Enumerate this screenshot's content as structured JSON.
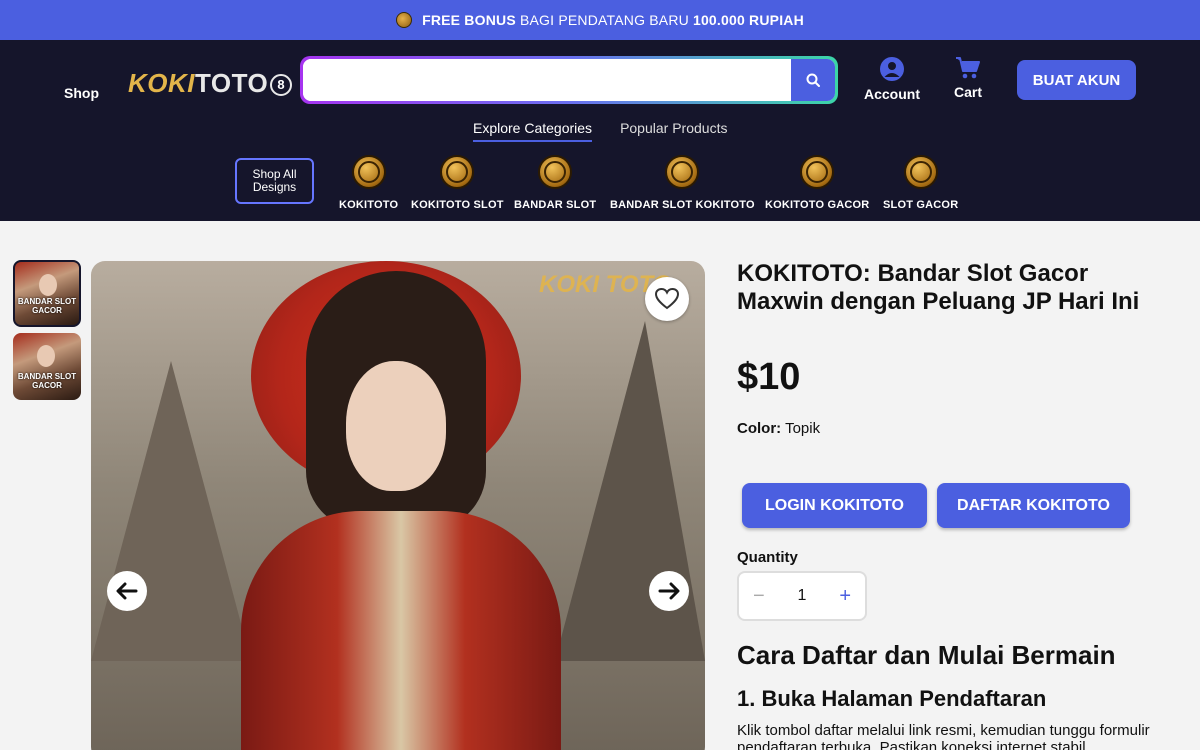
{
  "promo": {
    "bold_lead": "FREE BONUS",
    "middle": "BAGI PENDATANG BARU",
    "bold_tail": "100.000 RUPIAH"
  },
  "header": {
    "shop": "Shop",
    "logo_koki": "KOKI",
    "logo_toto": "TOTO",
    "logo_num": "8",
    "search_value": "",
    "account": "Account",
    "cart": "Cart",
    "create_account": "BUAT AKUN"
  },
  "tabs": [
    {
      "label": "Explore Categories",
      "active": true
    },
    {
      "label": "Popular Products",
      "active": false
    }
  ],
  "categories": {
    "shop_all": "Shop All Designs",
    "items": [
      "KOKITOTO",
      "KOKITOTO SLOT",
      "BANDAR SLOT",
      "BANDAR SLOT KOKITOTO",
      "KOKITOTO GACOR",
      "SLOT GACOR"
    ]
  },
  "gallery": {
    "thumb_caption": "BANDAR SLOT GACOR",
    "watermark": "KOKI TOTO"
  },
  "product": {
    "title": "KOKITOTO: Bandar Slot Gacor Maxwin dengan Peluang JP Hari Ini",
    "price": "$10",
    "color_label": "Color:",
    "color_value": "Topik",
    "login_button": "LOGIN KOKITOTO",
    "daftar_button": "DAFTAR KOKITOTO",
    "quantity_label": "Quantity",
    "quantity_minus": "−",
    "quantity_value": "1",
    "quantity_plus": "+"
  },
  "content": {
    "heading": "Cara Daftar dan Mulai Bermain",
    "subheading": "1. Buka Halaman Pendaftaran",
    "paragraph": "Klik tombol daftar melalui link resmi, kemudian tunggu formulir pendaftaran terbuka. Pastikan koneksi internet stabil"
  },
  "colors": {
    "accent": "#4b5fe0",
    "header_bg": "#15152b",
    "gold": "#e3b54a"
  }
}
